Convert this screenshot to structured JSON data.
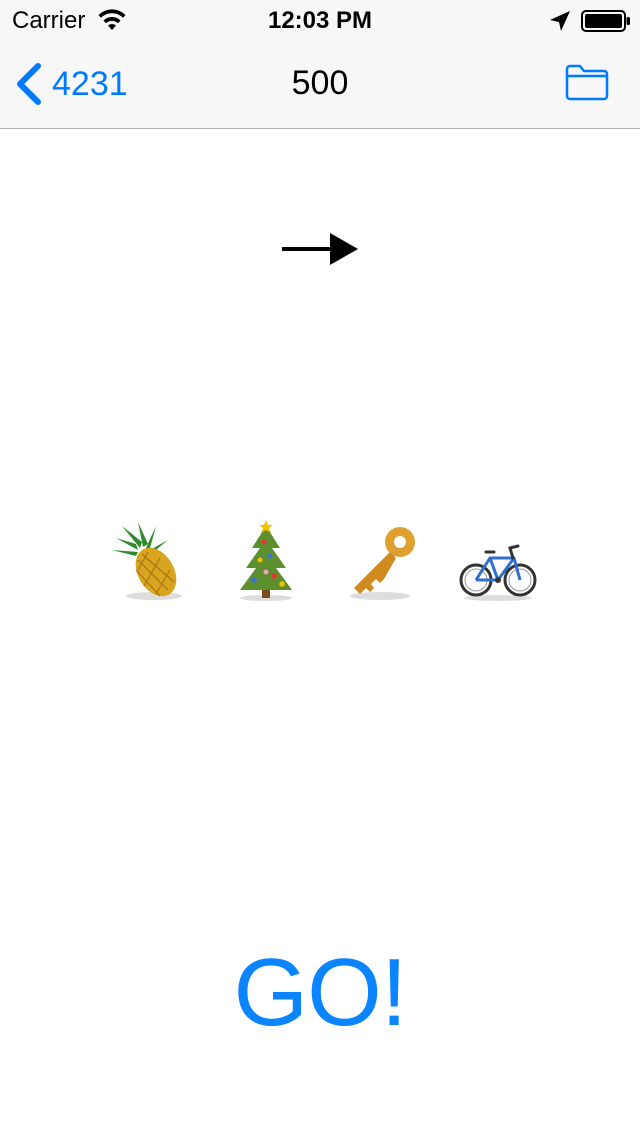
{
  "status_bar": {
    "carrier": "Carrier",
    "time": "12:03 PM",
    "icons": [
      "wifi-icon",
      "location-arrow-icon",
      "battery-icon"
    ]
  },
  "nav": {
    "back_label": "4231",
    "title": "500",
    "right_icon": "folder-icon"
  },
  "puzzle": {
    "arrow_icon": "right-arrow-icon",
    "emojis": [
      "pineapple",
      "christmas-tree",
      "key",
      "bicycle"
    ]
  },
  "action": {
    "go_label": "GO!"
  },
  "colors": {
    "accent": "#007aff",
    "nav_background": "#f7f7f7",
    "separator": "#b2b2b2"
  }
}
